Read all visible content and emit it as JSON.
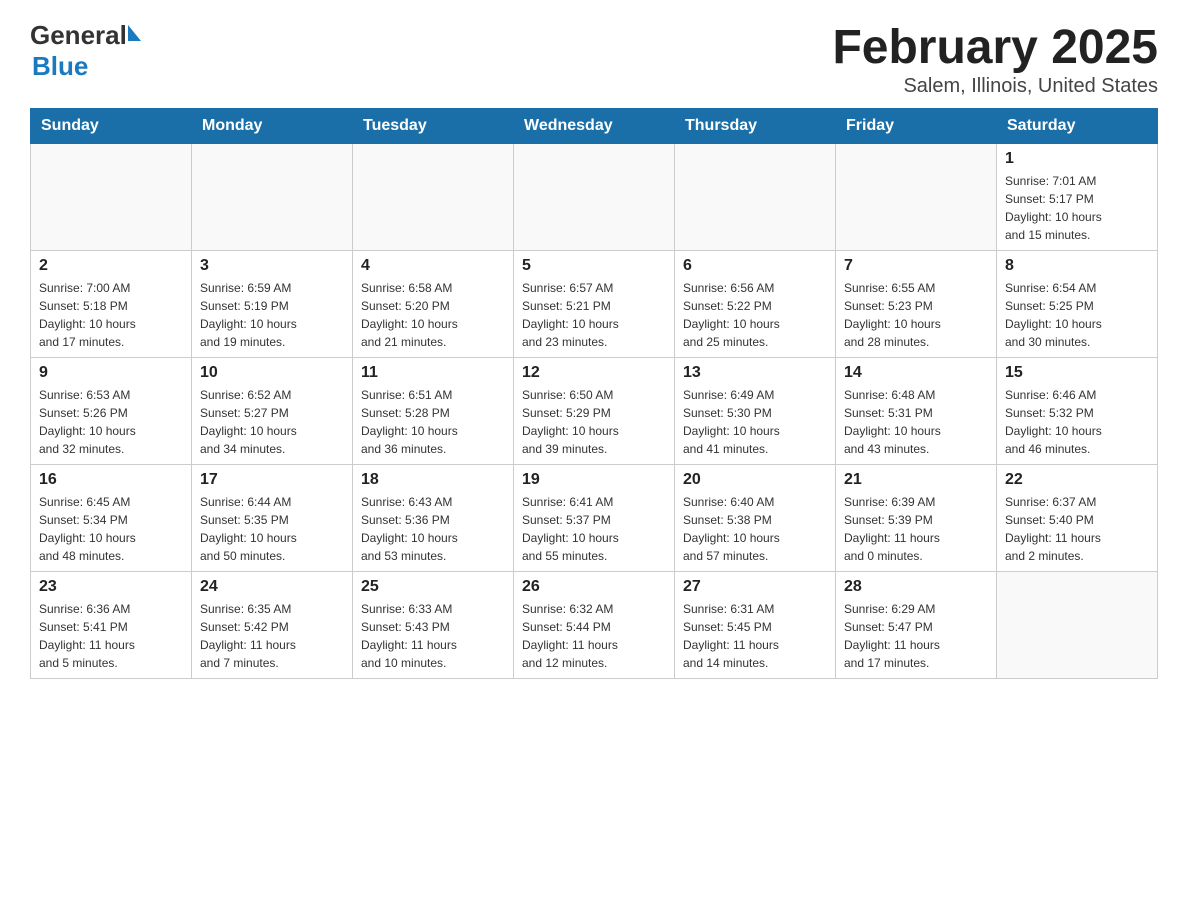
{
  "header": {
    "logo_general": "General",
    "logo_blue": "Blue",
    "title": "February 2025",
    "subtitle": "Salem, Illinois, United States"
  },
  "days_of_week": [
    "Sunday",
    "Monday",
    "Tuesday",
    "Wednesday",
    "Thursday",
    "Friday",
    "Saturday"
  ],
  "weeks": [
    [
      {
        "day": "",
        "info": ""
      },
      {
        "day": "",
        "info": ""
      },
      {
        "day": "",
        "info": ""
      },
      {
        "day": "",
        "info": ""
      },
      {
        "day": "",
        "info": ""
      },
      {
        "day": "",
        "info": ""
      },
      {
        "day": "1",
        "info": "Sunrise: 7:01 AM\nSunset: 5:17 PM\nDaylight: 10 hours\nand 15 minutes."
      }
    ],
    [
      {
        "day": "2",
        "info": "Sunrise: 7:00 AM\nSunset: 5:18 PM\nDaylight: 10 hours\nand 17 minutes."
      },
      {
        "day": "3",
        "info": "Sunrise: 6:59 AM\nSunset: 5:19 PM\nDaylight: 10 hours\nand 19 minutes."
      },
      {
        "day": "4",
        "info": "Sunrise: 6:58 AM\nSunset: 5:20 PM\nDaylight: 10 hours\nand 21 minutes."
      },
      {
        "day": "5",
        "info": "Sunrise: 6:57 AM\nSunset: 5:21 PM\nDaylight: 10 hours\nand 23 minutes."
      },
      {
        "day": "6",
        "info": "Sunrise: 6:56 AM\nSunset: 5:22 PM\nDaylight: 10 hours\nand 25 minutes."
      },
      {
        "day": "7",
        "info": "Sunrise: 6:55 AM\nSunset: 5:23 PM\nDaylight: 10 hours\nand 28 minutes."
      },
      {
        "day": "8",
        "info": "Sunrise: 6:54 AM\nSunset: 5:25 PM\nDaylight: 10 hours\nand 30 minutes."
      }
    ],
    [
      {
        "day": "9",
        "info": "Sunrise: 6:53 AM\nSunset: 5:26 PM\nDaylight: 10 hours\nand 32 minutes."
      },
      {
        "day": "10",
        "info": "Sunrise: 6:52 AM\nSunset: 5:27 PM\nDaylight: 10 hours\nand 34 minutes."
      },
      {
        "day": "11",
        "info": "Sunrise: 6:51 AM\nSunset: 5:28 PM\nDaylight: 10 hours\nand 36 minutes."
      },
      {
        "day": "12",
        "info": "Sunrise: 6:50 AM\nSunset: 5:29 PM\nDaylight: 10 hours\nand 39 minutes."
      },
      {
        "day": "13",
        "info": "Sunrise: 6:49 AM\nSunset: 5:30 PM\nDaylight: 10 hours\nand 41 minutes."
      },
      {
        "day": "14",
        "info": "Sunrise: 6:48 AM\nSunset: 5:31 PM\nDaylight: 10 hours\nand 43 minutes."
      },
      {
        "day": "15",
        "info": "Sunrise: 6:46 AM\nSunset: 5:32 PM\nDaylight: 10 hours\nand 46 minutes."
      }
    ],
    [
      {
        "day": "16",
        "info": "Sunrise: 6:45 AM\nSunset: 5:34 PM\nDaylight: 10 hours\nand 48 minutes."
      },
      {
        "day": "17",
        "info": "Sunrise: 6:44 AM\nSunset: 5:35 PM\nDaylight: 10 hours\nand 50 minutes."
      },
      {
        "day": "18",
        "info": "Sunrise: 6:43 AM\nSunset: 5:36 PM\nDaylight: 10 hours\nand 53 minutes."
      },
      {
        "day": "19",
        "info": "Sunrise: 6:41 AM\nSunset: 5:37 PM\nDaylight: 10 hours\nand 55 minutes."
      },
      {
        "day": "20",
        "info": "Sunrise: 6:40 AM\nSunset: 5:38 PM\nDaylight: 10 hours\nand 57 minutes."
      },
      {
        "day": "21",
        "info": "Sunrise: 6:39 AM\nSunset: 5:39 PM\nDaylight: 11 hours\nand 0 minutes."
      },
      {
        "day": "22",
        "info": "Sunrise: 6:37 AM\nSunset: 5:40 PM\nDaylight: 11 hours\nand 2 minutes."
      }
    ],
    [
      {
        "day": "23",
        "info": "Sunrise: 6:36 AM\nSunset: 5:41 PM\nDaylight: 11 hours\nand 5 minutes."
      },
      {
        "day": "24",
        "info": "Sunrise: 6:35 AM\nSunset: 5:42 PM\nDaylight: 11 hours\nand 7 minutes."
      },
      {
        "day": "25",
        "info": "Sunrise: 6:33 AM\nSunset: 5:43 PM\nDaylight: 11 hours\nand 10 minutes."
      },
      {
        "day": "26",
        "info": "Sunrise: 6:32 AM\nSunset: 5:44 PM\nDaylight: 11 hours\nand 12 minutes."
      },
      {
        "day": "27",
        "info": "Sunrise: 6:31 AM\nSunset: 5:45 PM\nDaylight: 11 hours\nand 14 minutes."
      },
      {
        "day": "28",
        "info": "Sunrise: 6:29 AM\nSunset: 5:47 PM\nDaylight: 11 hours\nand 17 minutes."
      },
      {
        "day": "",
        "info": ""
      }
    ]
  ]
}
